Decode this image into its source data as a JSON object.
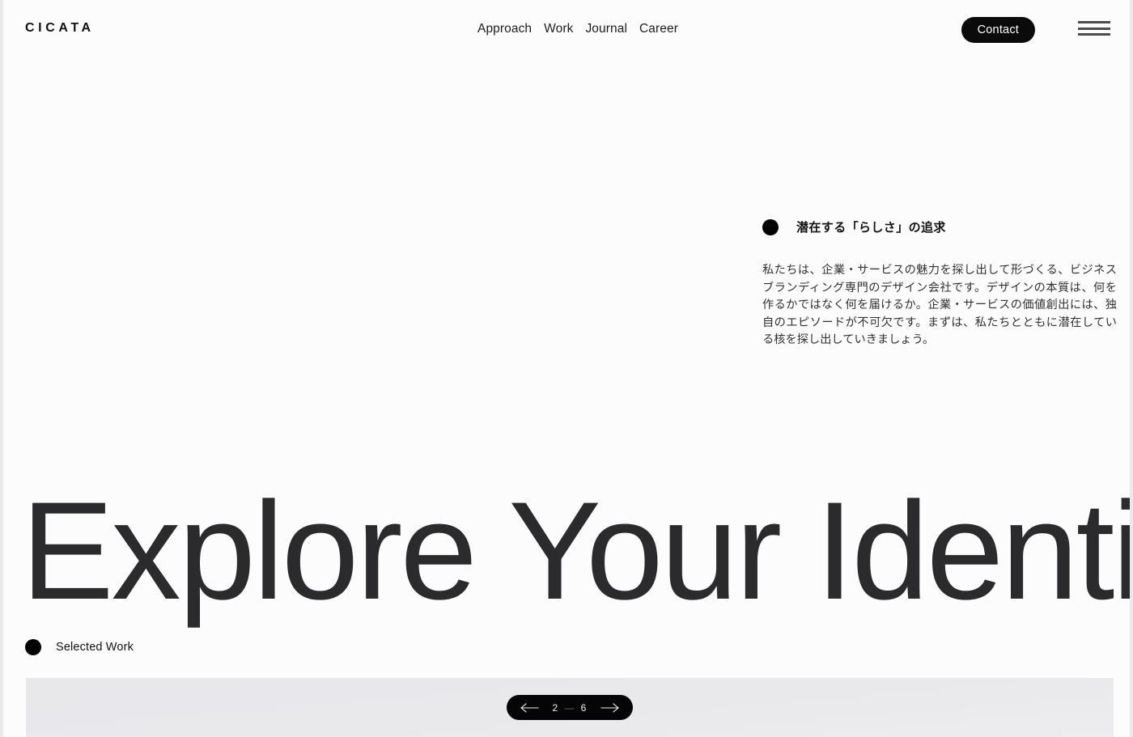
{
  "site": {
    "logo": "CICATA",
    "background_color": "#fcfcfc",
    "accent_color": "#000000"
  },
  "header": {
    "nav": [
      {
        "label": "Approach",
        "name": "nav-link-approach"
      },
      {
        "label": "Work",
        "name": "nav-link-work"
      },
      {
        "label": "Journal",
        "name": "nav-link-journal"
      },
      {
        "label": "Career",
        "name": "nav-link-career"
      }
    ],
    "contact_label": "Contact",
    "menu_icon": "hamburger-menu-icon"
  },
  "intro": {
    "bullet_icon": "bullet-dot-icon",
    "title": "潜在する「らしさ」の追求",
    "body": "私たちは、企業・サービスの魅力を探し出して形づくる、ビジネスブランディング専門のデザイン会社です。デザインの本質は、何を作るかではなく何を届けるか。企業・サービスの価値創出には、独自のエピソードが不可欠です。まずは、私たちとともに潜在している核を探し出していきましょう。"
  },
  "hero": {
    "title": "Explore Your Identity"
  },
  "selected_work": {
    "bullet_icon": "bullet-dot-icon",
    "label": "Selected Work"
  },
  "carousel": {
    "prev_icon": "arrow-left-icon",
    "next_icon": "arrow-right-icon",
    "current": "2",
    "separator": "—",
    "total": "6"
  }
}
